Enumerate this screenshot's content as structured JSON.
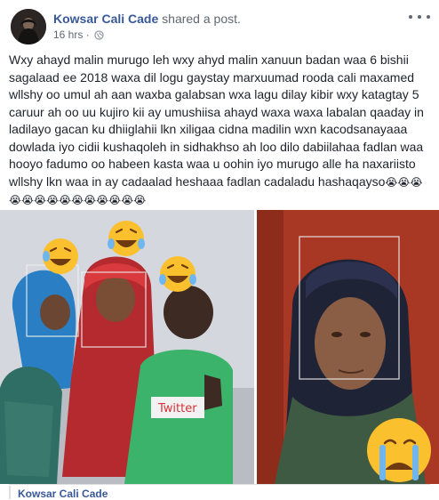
{
  "post": {
    "author": "Kowsar Cali Cade",
    "action": "shared a post.",
    "timestamp": "16 hrs",
    "separator": "·",
    "body": "Wxy ahayd malin murugo leh wxy ahyd malin xanuun badan waa 6 bishii sagalaad ee 2018 waxa dil logu gaystay marxuumad rooda cali maxamed wllshy oo umul ah aan waxba galabsan wxa lagu dilay kibir wxy katagtay 5 caruur ah oo uu kujiro kii ay umushiisa ahayd waxa waxa labalan qaaday in ladilayo gacan ku dhiiglahii lkn xiligaa cidna madilin wxn kacodsanayaaa dowlada iyo cidii kushaqoleh in sidhakhso ah loo dilo dabiilahaa fadlan waa hooyo fadumo oo habeen kasta waa u oohin iyo murugo alle ha naxariisto wllshy lkn waa in ay cadaalad heshaaa fadlan cadaladu hashaqayso",
    "emoji_tail": "😭😭😭😭😭😭😭😭😭😭😭😭😭😭"
  },
  "shared": {
    "author": "Kowsar Cali Cade"
  },
  "icons": {
    "more": "more-options-icon",
    "privacy": "globe-icon",
    "avatar": "profile-avatar"
  },
  "colors": {
    "link": "#385898",
    "meta": "#616770",
    "text": "#1d2129",
    "divider": "#dddfe2"
  }
}
